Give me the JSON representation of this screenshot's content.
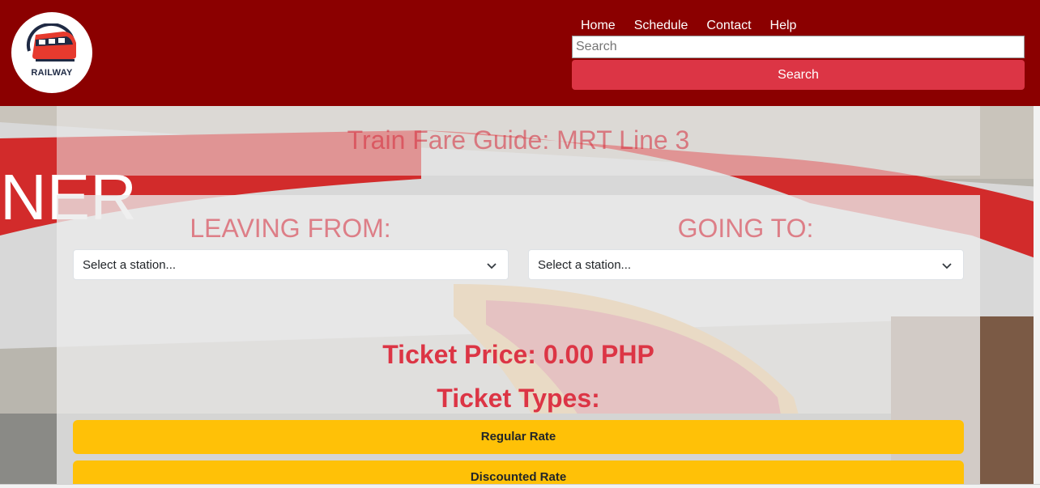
{
  "header": {
    "logo_text": "RAILWAY",
    "nav": [
      "Home",
      "Schedule",
      "Contact",
      "Help"
    ],
    "search_placeholder": "Search",
    "search_button": "Search"
  },
  "main": {
    "title": "Train Fare Guide: MRT Line 3",
    "leaving_label": "LEAVING FROM:",
    "going_label": "GOING TO:",
    "leaving_select": "Select a station...",
    "going_select": "Select a station...",
    "price_text": "Ticket Price: 0.00 PHP",
    "types_heading": "Ticket Types:",
    "regular_button": "Regular Rate",
    "discount_button": "Discounted Rate"
  },
  "colors": {
    "header_bg": "#8b0000",
    "accent_red": "#dc3545",
    "rate_button": "#ffc107"
  },
  "icons": {
    "logo": "train-icon",
    "select": "chevron-down-icon"
  }
}
